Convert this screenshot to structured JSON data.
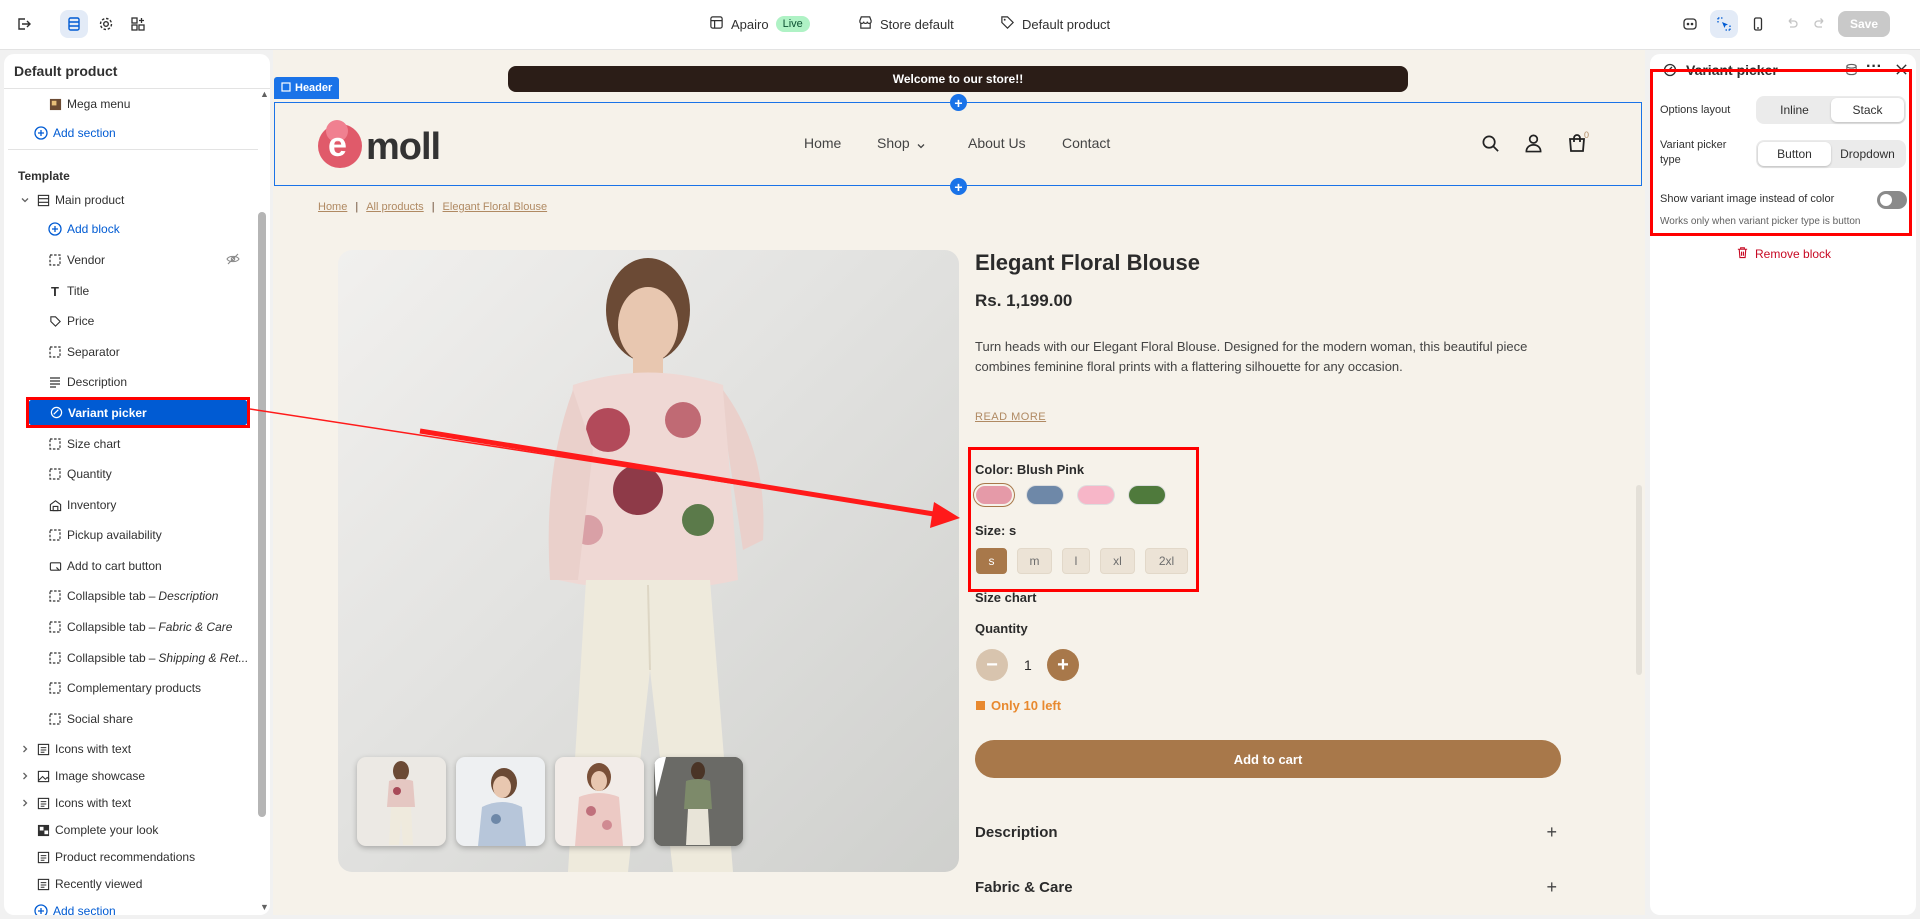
{
  "topbar": {
    "store_name": "Apairo",
    "live_badge": "Live",
    "theme": "Store default",
    "template": "Default product",
    "save_label": "Save"
  },
  "left_panel": {
    "title": "Default product",
    "mega_menu": "Mega menu",
    "add_section_top": "Add section",
    "template_heading": "Template",
    "main_product": "Main product",
    "add_block": "Add block",
    "blocks": [
      {
        "label": "Vendor",
        "icon": "dashed-square-icon"
      },
      {
        "label": "Title",
        "icon": "text-icon"
      },
      {
        "label": "Price",
        "icon": "price-tag-icon"
      },
      {
        "label": "Separator",
        "icon": "dashed-square-icon"
      },
      {
        "label": "Description",
        "icon": "paragraph-icon"
      },
      {
        "label": "Variant picker",
        "icon": "variant-icon"
      },
      {
        "label": "Size chart",
        "icon": "dashed-square-icon"
      },
      {
        "label": "Quantity",
        "icon": "dashed-square-icon"
      },
      {
        "label": "Inventory",
        "icon": "inventory-icon"
      },
      {
        "label": "Pickup availability",
        "icon": "dashed-square-icon"
      },
      {
        "label": "Add to cart button",
        "icon": "cart-button-icon"
      },
      {
        "label": "Collapsible tab",
        "italic": "Description",
        "icon": "dashed-square-icon"
      },
      {
        "label": "Collapsible tab",
        "italic": "Fabric & Care",
        "icon": "dashed-square-icon"
      },
      {
        "label": "Collapsible tab",
        "italic": "Shipping & Ret...",
        "icon": "dashed-square-icon"
      },
      {
        "label": "Complementary products",
        "icon": "dashed-square-icon"
      },
      {
        "label": "Social share",
        "icon": "dashed-square-icon"
      }
    ],
    "sections": [
      {
        "label": "Icons with text",
        "icon": "list-icon"
      },
      {
        "label": "Image showcase",
        "icon": "image-icon"
      },
      {
        "label": "Icons with text",
        "icon": "list-icon"
      },
      {
        "label": "Complete your look",
        "icon": "look-icon"
      },
      {
        "label": "Product recommendations",
        "icon": "list-icon"
      },
      {
        "label": "Recently viewed",
        "icon": "list-icon"
      }
    ],
    "add_section_bottom": "Add section",
    "tab_separator": "–"
  },
  "canvas": {
    "announcement": "Welcome to our store!!",
    "header_tag": "Header",
    "logo": {
      "e": "e",
      "rest": "moll"
    },
    "nav": [
      "Home",
      "Shop",
      "About Us",
      "Contact"
    ],
    "cart_count": "0",
    "breadcrumb": [
      "Home",
      "All products",
      "Elegant Floral Blouse"
    ],
    "product": {
      "title": "Elegant Floral Blouse",
      "price": "Rs. 1,199.00",
      "description": "Turn heads with our Elegant Floral Blouse. Designed for the modern woman, this beautiful piece combines feminine floral prints with a flattering silhouette for any occasion.",
      "read_more": "READ MORE",
      "color_label": "Color: Blush Pink",
      "swatches": [
        "#e59aa8",
        "#6e88a8",
        "#f7b6c8",
        "#4f7a3c"
      ],
      "size_label": "Size: s",
      "sizes": [
        "s",
        "m",
        "l",
        "xl",
        "2xl"
      ],
      "selected_size": "s",
      "size_chart": "Size chart",
      "quantity_label": "Quantity",
      "quantity": "1",
      "stock": "Only 10 left",
      "add_to_cart": "Add to cart",
      "tabs": [
        "Description",
        "Fabric & Care"
      ]
    },
    "colors": {
      "accent": "#a8784a",
      "stock": "#e8892f",
      "bg": "#f6f2ea"
    }
  },
  "right_panel": {
    "title": "Variant picker",
    "options_layout_label": "Options layout",
    "options_layout": [
      "Inline",
      "Stack"
    ],
    "options_layout_selected": "Stack",
    "picker_type_label": "Variant picker type",
    "picker_type": [
      "Button",
      "Dropdown"
    ],
    "picker_type_selected": "Button",
    "variant_image_label": "Show variant image instead of color",
    "variant_image_enabled": false,
    "help": "Works only when variant picker type is button",
    "remove_block": "Remove block"
  }
}
